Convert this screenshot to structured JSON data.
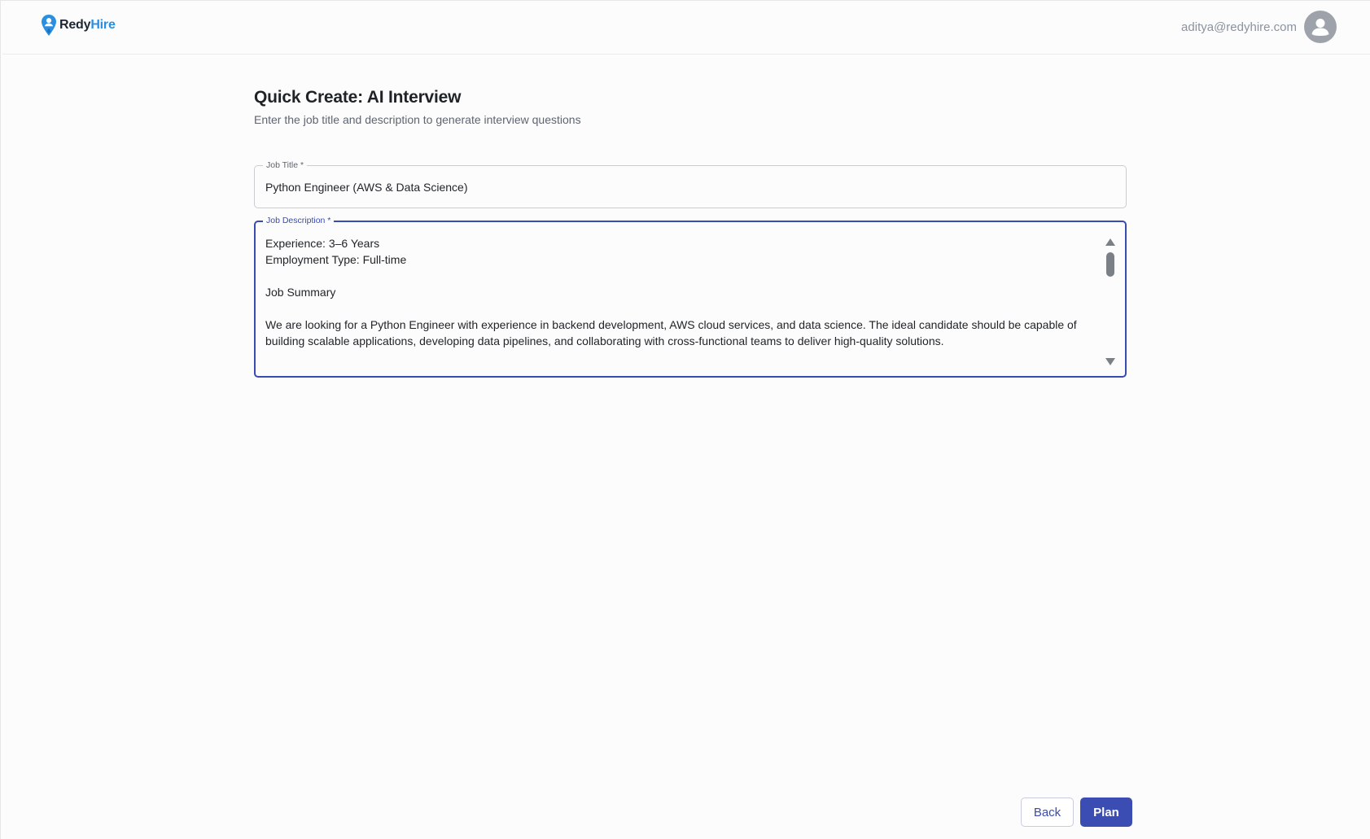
{
  "header": {
    "logo": {
      "part1": "Redy",
      "part2": "Hire"
    },
    "user_email": "aditya@redyhire.com"
  },
  "main": {
    "title": "Quick Create: AI Interview",
    "subtitle": "Enter the job title and description to generate interview questions",
    "job_title_field": {
      "label": "Job Title *",
      "value": "Python Engineer (AWS & Data Science)"
    },
    "job_description_field": {
      "label": "Job Description *",
      "lines": [
        "Experience: 3–6 Years",
        "Employment Type: Full-time",
        "",
        "Job Summary",
        "",
        "We are looking for a Python Engineer with experience in backend development, AWS cloud services, and data science. The ideal candidate should be capable of building scalable applications, developing data pipelines, and collaborating with cross-functional teams to deliver high-quality solutions."
      ]
    }
  },
  "footer": {
    "back_label": "Back",
    "plan_label": "Plan"
  },
  "colors": {
    "primary": "#3b4db3",
    "logo_blue": "#2a8fe0",
    "focus_border": "#3a4bb0"
  },
  "icons": {
    "logo": "location-pin-person-icon",
    "avatar": "user-avatar-icon",
    "scroll_up": "triangle-up-icon",
    "scroll_down": "triangle-down-icon"
  }
}
